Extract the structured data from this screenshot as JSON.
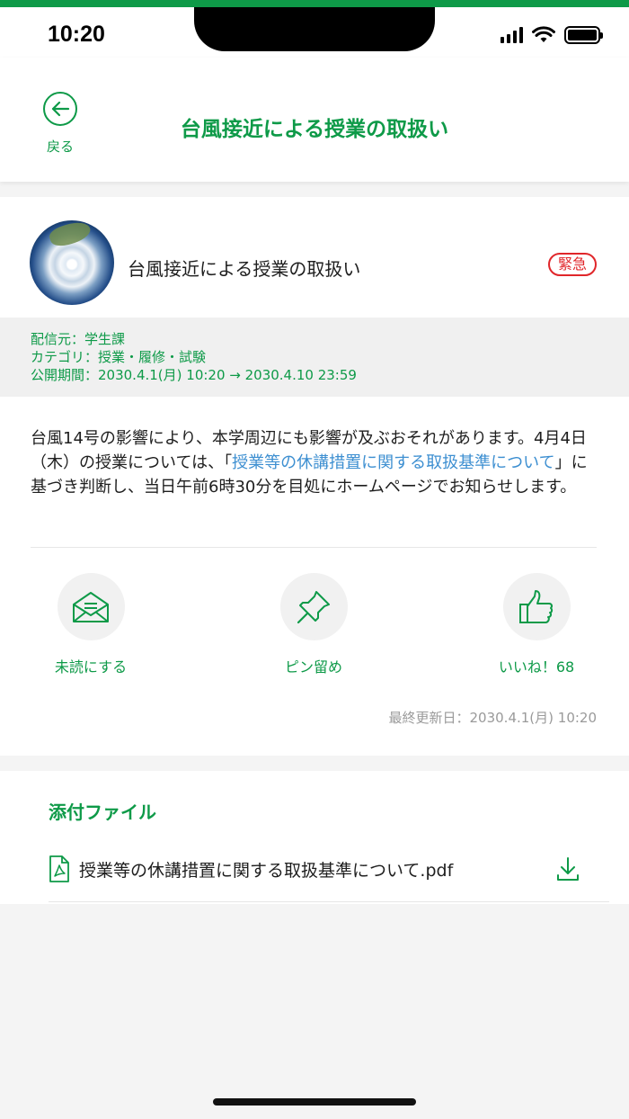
{
  "status_bar": {
    "time": "10:20"
  },
  "header": {
    "back_label": "戻る",
    "title": "台風接近による授業の取扱い"
  },
  "notice": {
    "title": "台風接近による授業の取扱い",
    "badge": "緊急",
    "sender": "配信元：学生課",
    "category": "カテゴリ：授業・履修・試験",
    "period": "公開期間：2030.4.1(月) 10:20 → 2030.4.10 23:59",
    "body_part1": "台風14号の影響により、本学周辺にも影響が及ぶおそれがあります。4月4日（木）の授業については、「",
    "body_link": "授業等の休講措置に関する取扱基準について",
    "body_part2": "」に基づき判断し、当日午前6時30分を目処にホームページでお知らせします。",
    "updated": "最終更新日：2030.4.1(月) 10:20"
  },
  "actions": {
    "mark_unread": "未読にする",
    "pin": "ピン留め",
    "like": "いいね！68"
  },
  "attachments": {
    "title": "添付ファイル",
    "file_name": "授業等の休講措置に関する取扱基準について.pdf"
  },
  "colors": {
    "accent": "#0e9a48",
    "urgent": "#e0262a",
    "link": "#3d8fd1"
  },
  "icons": [
    "back-arrow-icon",
    "envelope-icon",
    "pin-icon",
    "thumbs-up-icon",
    "pdf-file-icon",
    "download-icon"
  ]
}
